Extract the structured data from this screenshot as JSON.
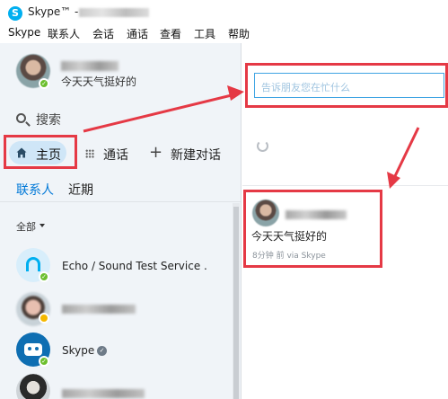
{
  "window": {
    "title": "Skype™ -"
  },
  "menu": [
    "Skype",
    "联系人",
    "会话",
    "通话",
    "查看",
    "工具",
    "帮助"
  ],
  "profile": {
    "mood": "今天天气挺好的",
    "status": "online"
  },
  "sidebar": {
    "search_label": "搜索",
    "nav": {
      "home": "主页",
      "call": "通话",
      "new_chat": "新建对话"
    },
    "tabs": {
      "contacts": "联系人",
      "recent": "近期"
    },
    "filter": "全部",
    "contacts": [
      {
        "name": "Echo / Sound Test Service .",
        "status": "online",
        "avatar": "headset-icon"
      },
      {
        "name": "",
        "status": "away",
        "avatar": "photo"
      },
      {
        "name": "Skype",
        "status": "online",
        "avatar": "skype-bot-icon",
        "verified": true
      },
      {
        "name": "",
        "status": "online",
        "avatar": "photo"
      }
    ]
  },
  "main": {
    "status_input_placeholder": "告诉朋友您在忙什么",
    "feed": [
      {
        "mood": "今天天气挺好的",
        "time": "8分钟 前 via Skype"
      }
    ]
  },
  "colors": {
    "accent": "#00aff0",
    "annotation": "#e53945",
    "online": "#6cbf2e",
    "away": "#f5b800"
  }
}
